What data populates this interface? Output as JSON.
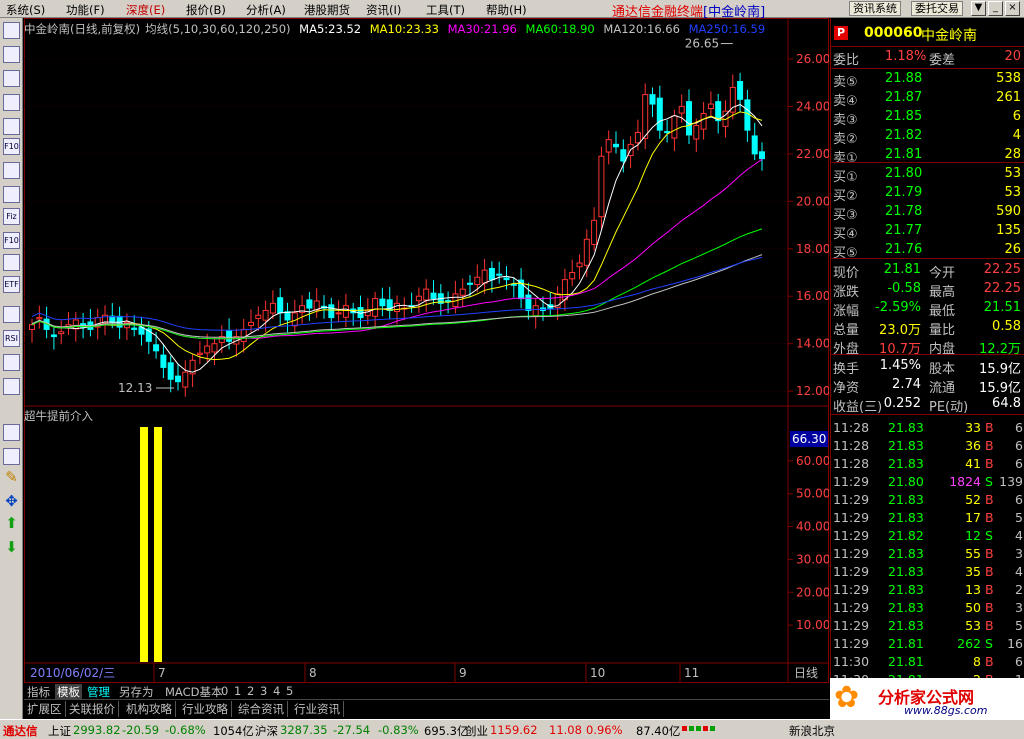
{
  "menubar": {
    "items": [
      "系统(S)",
      "功能(F)",
      "深度(E)",
      "报价(B)",
      "分析(A)",
      "港股期货",
      "资讯(I)",
      "工具(T)",
      "帮助(H)"
    ],
    "active_index": 2,
    "app_title": "通达信金融终端",
    "stock_title": "[中金岭南]",
    "btn_news": "资讯系统",
    "btn_trade": "委托交易"
  },
  "window_controls": [
    "▼",
    "_",
    "▫",
    "×"
  ],
  "toolbar": {
    "icons": [
      "cursor-icon",
      "grid-icon",
      "minute-chart-icon",
      "kline-icon",
      "report-icon",
      "f10-icon",
      "info-icon",
      "news-icon",
      "fiz-icon",
      "f10-circle-icon",
      "search-icon",
      "etf-icon",
      "indicator-icon",
      "rsi-icon",
      "refresh-icon",
      "exit-icon",
      "bookmark-icon",
      "enter-icon",
      "pencil-icon",
      "move-icon",
      "up-arrow-icon",
      "down-arrow-icon"
    ],
    "labels": [
      "",
      "",
      "",
      "",
      "",
      "F10",
      "",
      "",
      "Fiz",
      "F10",
      "",
      "ETF",
      "",
      "RSI",
      "",
      "",
      "",
      "",
      "",
      "",
      "",
      ""
    ]
  },
  "chart": {
    "header_stock": "中金岭南(日线,前复权)",
    "header_ma_label": "均线(5,10,30,60,120,250)",
    "ma_values": [
      {
        "label": "MA5:23.52",
        "color": "#ffffff"
      },
      {
        "label": "MA10:23.33",
        "color": "#ffff00"
      },
      {
        "label": "MA30:21.96",
        "color": "#ff00ff"
      },
      {
        "label": "MA60:18.90",
        "color": "#00ff00"
      },
      {
        "label": "MA120:16.66",
        "color": "#c0c0c0"
      },
      {
        "label": "MA250:16.59",
        "color": "#0000ff"
      }
    ],
    "indicator_title": "超牛提前介入",
    "indicator_value": "66.30",
    "high_label": "26.65",
    "low_label": "12.13",
    "date_label": "2010/06/02/三",
    "month_labels": [
      "7",
      "8",
      "9",
      "10",
      "11"
    ],
    "period_label": "日线",
    "price_axis": [
      "26.00",
      "24.00",
      "22.00",
      "20.00",
      "18.00",
      "16.00",
      "14.00",
      "12.00"
    ],
    "ind_axis": [
      "60.00",
      "50.00",
      "40.00",
      "30.00",
      "20.00",
      "10.00"
    ],
    "colors": {
      "up": "#ff3232",
      "down": "#00ffff",
      "frame": "#800000"
    }
  },
  "chart_data": {
    "type": "candlestick",
    "title": "中金岭南(日线,前复权)",
    "price_range": [
      11.5,
      26.8
    ],
    "closes": [
      14.8,
      15.1,
      14.6,
      14.3,
      14.5,
      14.8,
      15.0,
      14.7,
      14.6,
      15.1,
      15.2,
      14.9,
      14.7,
      14.9,
      14.6,
      14.4,
      14.1,
      13.7,
      13.0,
      12.5,
      12.4,
      12.8,
      13.3,
      13.6,
      13.9,
      14.0,
      14.3,
      14.1,
      14.3,
      14.6,
      14.9,
      15.2,
      15.4,
      15.7,
      15.3,
      15.0,
      15.3,
      15.6,
      15.5,
      15.8,
      15.5,
      15.1,
      15.3,
      15.6,
      15.3,
      15.1,
      15.4,
      15.9,
      15.6,
      15.4,
      15.7,
      15.5,
      15.6,
      16.0,
      16.3,
      15.9,
      15.7,
      15.8,
      16.1,
      16.3,
      16.5,
      16.8,
      17.1,
      16.7,
      16.9,
      16.7,
      16.5,
      15.9,
      15.4,
      15.6,
      15.4,
      15.5,
      16.1,
      16.7,
      17.0,
      17.4,
      18.4,
      19.2,
      21.9,
      22.6,
      22.3,
      21.7,
      22.4,
      22.9,
      24.5,
      24.1,
      23.0,
      22.9,
      23.6,
      24.0,
      22.8,
      23.2,
      23.7,
      24.1,
      23.4,
      23.8,
      24.8,
      24.3,
      23.0,
      22.0,
      21.8
    ],
    "indicator_bars": [
      {
        "index": 0,
        "value": 100
      },
      {
        "index": 1,
        "value": 100
      }
    ],
    "ma_last": {
      "MA5": 23.52,
      "MA10": 23.33,
      "MA30": 21.96,
      "MA60": 18.9,
      "MA120": 16.66,
      "MA250": 16.59
    }
  },
  "bottom_tabs": {
    "row1": [
      "指标",
      "模板",
      "管理",
      "另存为",
      "MACD基本",
      "0",
      "1",
      "2",
      "3",
      "4",
      "5"
    ],
    "row1_selected": 1,
    "row2": [
      "扩展区",
      "关联报价",
      "机构攻略",
      "行业攻略",
      "综合资讯",
      "行业资讯"
    ]
  },
  "statusbar": {
    "brand": "通达信",
    "sh_label": "上证",
    "sh_value": "2993.82",
    "sh_change": "-20.59",
    "sh_pct": "-0.68%",
    "sh_amount": "1054亿",
    "sz_label": "沪深",
    "sz_value": "3287.35",
    "sz_change": "-27.54",
    "sz_pct": "-0.83%",
    "sz_amount": "695.3亿",
    "cy_label": "创业",
    "cy_value": "1159.62",
    "cy_change": "11.08",
    "cy_pct": "0.96%",
    "cy_amount": "87.40亿",
    "news": "新浪北京"
  },
  "quote": {
    "logo": "P",
    "code": "000060",
    "name": "中金岭南",
    "wb_label": "委比",
    "wb_value": "1.18%",
    "wc_label": "委差",
    "wc_value": "20",
    "sells": [
      {
        "label": "卖⑤",
        "price": "21.88",
        "vol": "538"
      },
      {
        "label": "卖④",
        "price": "21.87",
        "vol": "261"
      },
      {
        "label": "卖③",
        "price": "21.85",
        "vol": "6"
      },
      {
        "label": "卖②",
        "price": "21.82",
        "vol": "4"
      },
      {
        "label": "卖①",
        "price": "21.81",
        "vol": "28"
      }
    ],
    "buys": [
      {
        "label": "买①",
        "price": "21.80",
        "vol": "53"
      },
      {
        "label": "买②",
        "price": "21.79",
        "vol": "53"
      },
      {
        "label": "买③",
        "price": "21.78",
        "vol": "590"
      },
      {
        "label": "买④",
        "price": "21.77",
        "vol": "135"
      },
      {
        "label": "买⑤",
        "price": "21.76",
        "vol": "26"
      }
    ],
    "stats": [
      {
        "l1": "现价",
        "v1": "21.81",
        "c1": "g",
        "l2": "今开",
        "v2": "22.25",
        "c2": "r"
      },
      {
        "l1": "涨跌",
        "v1": "-0.58",
        "c1": "g",
        "l2": "最高",
        "v2": "22.25",
        "c2": "r"
      },
      {
        "l1": "涨幅",
        "v1": "-2.59%",
        "c1": "g",
        "l2": "最低",
        "v2": "21.51",
        "c2": "g"
      },
      {
        "l1": "总量",
        "v1": "23.0万",
        "c1": "y",
        "l2": "量比",
        "v2": "0.58",
        "c2": "y"
      },
      {
        "l1": "外盘",
        "v1": "10.7万",
        "c1": "r",
        "l2": "内盘",
        "v2": "12.2万",
        "c2": "g"
      }
    ],
    "stats2": [
      {
        "l1": "换手",
        "v1": "1.45%",
        "c1": "w",
        "l2": "股本",
        "v2": "15.9亿",
        "c2": "w"
      },
      {
        "l1": "净资",
        "v1": "2.74",
        "c1": "w",
        "l2": "流通",
        "v2": "15.9亿",
        "c2": "w"
      },
      {
        "l1": "收益(三)",
        "v1": "0.252",
        "c1": "w",
        "l2": "PE(动)",
        "v2": "64.8",
        "c2": "w"
      }
    ],
    "ticks": [
      {
        "time": "11:28",
        "price": "21.83",
        "vol": "33",
        "bs": "B",
        "n": "6"
      },
      {
        "time": "11:28",
        "price": "21.83",
        "vol": "36",
        "bs": "B",
        "n": "6"
      },
      {
        "time": "11:28",
        "price": "21.83",
        "vol": "41",
        "bs": "B",
        "n": "6"
      },
      {
        "time": "11:29",
        "price": "21.80",
        "vol": "1824",
        "bs": "S",
        "n": "139"
      },
      {
        "time": "11:29",
        "price": "21.83",
        "vol": "52",
        "bs": "B",
        "n": "6"
      },
      {
        "time": "11:29",
        "price": "21.83",
        "vol": "17",
        "bs": "B",
        "n": "5"
      },
      {
        "time": "11:29",
        "price": "21.82",
        "vol": "12",
        "bs": "S",
        "n": "4"
      },
      {
        "time": "11:29",
        "price": "21.83",
        "vol": "55",
        "bs": "B",
        "n": "3"
      },
      {
        "time": "11:29",
        "price": "21.83",
        "vol": "35",
        "bs": "B",
        "n": "4"
      },
      {
        "time": "11:29",
        "price": "21.83",
        "vol": "13",
        "bs": "B",
        "n": "2"
      },
      {
        "time": "11:29",
        "price": "21.83",
        "vol": "50",
        "bs": "B",
        "n": "3"
      },
      {
        "time": "11:29",
        "price": "21.83",
        "vol": "53",
        "bs": "B",
        "n": "5"
      },
      {
        "time": "11:29",
        "price": "21.81",
        "vol": "262",
        "bs": "S",
        "n": "16"
      },
      {
        "time": "11:30",
        "price": "21.81",
        "vol": "8",
        "bs": "B",
        "n": "6"
      },
      {
        "time": "11:30",
        "price": "21.81",
        "vol": "2",
        "bs": "B",
        "n": "1"
      }
    ]
  },
  "watermark": {
    "text": "分析家公式网",
    "url": "www.88gs.com"
  }
}
